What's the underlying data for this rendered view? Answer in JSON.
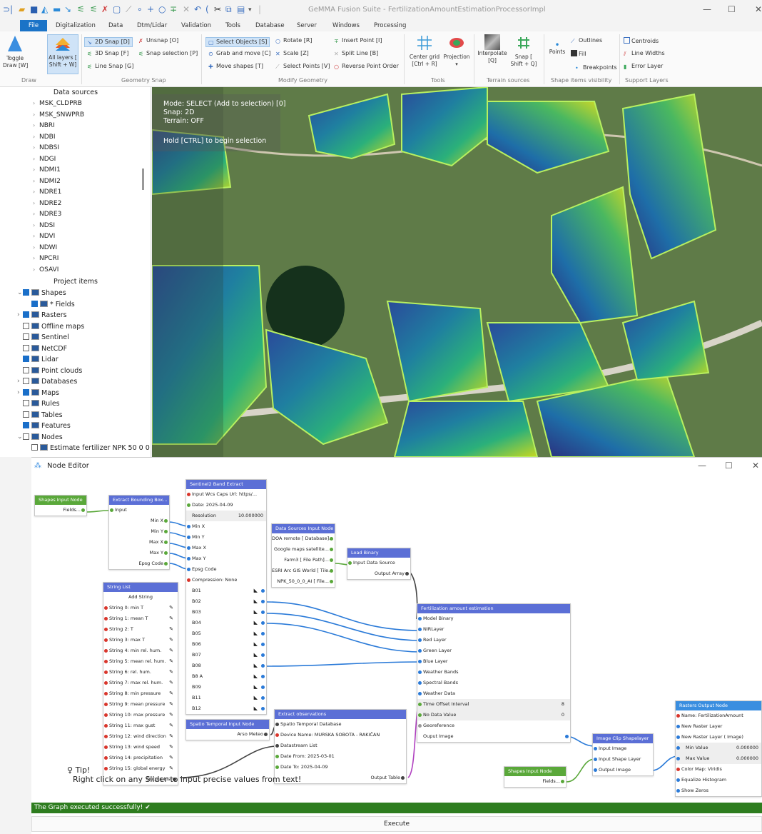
{
  "app": {
    "title": "GeMMA Fusion Suite - FertilizationAmountEstimationProcessorImpl"
  },
  "menu": [
    "File",
    "Digitalization",
    "Data",
    "Dtm/Lidar",
    "Validation",
    "Tools",
    "Database",
    "Server",
    "Windows",
    "Processing"
  ],
  "ribbon": {
    "toggle_draw": "Toggle\nDraw [W]",
    "all_layers": "All layers [\nShift + W]",
    "snap2d": "2D Snap [D]",
    "snap3d": "3D Snap [F]",
    "line_snap": "Line Snap [G]",
    "unsnap": "Unsnap [O]",
    "snap_selection": "Snap selection [P]",
    "select_objects": "Select Objects [S]",
    "grab_move": "Grab and move [C]",
    "move_shapes": "Move shapes [T]",
    "rotate": "Rotate [R]",
    "scale": "Scale [Z]",
    "select_points": "Select Points [V]",
    "insert_point": "Insert Point [I]",
    "split_line": "Split Line [B]",
    "reverse_point_order": "Reverse Point Order",
    "center_grid": "Center grid\n[Ctrl + R]",
    "projection": "Projection",
    "interpolate": "Interpolate\n[Q]",
    "snap_shift_q": "Snap [\nShift + Q]",
    "points": "Points",
    "outlines": "Outlines",
    "fill": "Fill",
    "breakpoints": "Breakpoints",
    "centroids": "Centroids",
    "line_widths": "Line Widths",
    "error_layer": "Error Layer",
    "groups": [
      "Draw",
      "Geometry Snap",
      "Modify Geometry",
      "Tools",
      "Terrain sources",
      "Shape items visibility",
      "Support Layers"
    ]
  },
  "data_sources": {
    "heading": "Data sources",
    "items": [
      "MSK_CLDPRB",
      "MSK_SNWPRB",
      "NBRI",
      "NDBI",
      "NDBSI",
      "NDGI",
      "NDMI1",
      "NDMI2",
      "NDRE1",
      "NDRE2",
      "NDRE3",
      "NDSI",
      "NDVI",
      "NDWI",
      "NPCRI",
      "OSAVI"
    ]
  },
  "project_items": {
    "heading": "Project items",
    "items": [
      {
        "label": "Shapes",
        "checked": true
      },
      {
        "label": "* Fields",
        "checked": true
      },
      {
        "label": "Rasters",
        "checked": true
      },
      {
        "label": "Offline maps",
        "checked": false
      },
      {
        "label": "Sentinel",
        "checked": false
      },
      {
        "label": "NetCDF",
        "checked": false
      },
      {
        "label": "Lidar",
        "checked": true
      },
      {
        "label": "Point clouds",
        "checked": false
      },
      {
        "label": "Databases",
        "checked": false
      },
      {
        "label": "Maps",
        "checked": true
      },
      {
        "label": "Rules",
        "checked": false
      },
      {
        "label": "Tables",
        "checked": false
      },
      {
        "label": "Features",
        "checked": true
      },
      {
        "label": "Nodes",
        "checked": false
      },
      {
        "label": "Estimate fertilizer NPK 50 0 0",
        "checked": false
      }
    ]
  },
  "map_info": {
    "mode": "Mode: SELECT (Add to selection) [0]",
    "snap": "Snap: 2D",
    "terrain": "Terrain: OFF",
    "hint": "Hold [CTRL] to begin selection"
  },
  "node_editor": {
    "title": "Node Editor",
    "shapes_input": {
      "title": "Shapes Input Node",
      "fields": "Fields..."
    },
    "bbox": {
      "title": "Extract Bounding Box...",
      "input": "Input",
      "outputs": [
        "Min X",
        "Min Y",
        "Max X",
        "Max Y",
        "Epsg Code"
      ]
    },
    "sentinel": {
      "title": "Sentinel2 Band Extract",
      "wcs": "Input Wcs Caps Url: https/...",
      "date": "Date: 2025-04-09",
      "resolution_label": "Resolution",
      "resolution_value": "10.000000",
      "inputs": [
        "Min X",
        "Min Y",
        "Max X",
        "Max Y",
        "Epsg Code"
      ],
      "compression": "Compression: None",
      "bands": [
        "B01",
        "B02",
        "B03",
        "B04",
        "B05",
        "B06",
        "B07",
        "B08",
        "B8 A",
        "B09",
        "B11",
        "B12"
      ]
    },
    "datasources": {
      "title": "Data Sources Input Node",
      "items": [
        "DOA remote [ Database]...",
        "Google maps satellite...",
        "Farm3 [ File Path]...",
        "ESRI Arc GIS World [ Tile...",
        "NPK_50_0_0_AI [ File..."
      ]
    },
    "load_binary": {
      "title": "Load Binary",
      "input": "Input Data Source",
      "output": "Output Array"
    },
    "string_list": {
      "title": "String List",
      "add": "Add String",
      "strings": [
        "String 0: min T",
        "String 1: mean T",
        "String 2: T",
        "String 3: max T",
        "String 4: min rel. hum.",
        "String 5: mean rel. hum.",
        "String 6: rel. hum.",
        "String 7: max rel. hum.",
        "String 8: min pressure",
        "String 9: mean pressure",
        "String 10: max pressure",
        "String 11: max gust",
        "String 12: wind direction",
        "String 13: wind speed",
        "String 14: precipitation",
        "String 15: global energy"
      ],
      "output": "Output List"
    },
    "spatio": {
      "title": "Spatio Temporal Input Node",
      "output": "Arso Meteo"
    },
    "extract_obs": {
      "title": "Extract observations",
      "db": "Spatio Temporal Database",
      "device": "Device Name: MURSKA SOBOTA - RAKIČAN",
      "list": "Datastream List",
      "from": "Date From: 2025-03-01",
      "to": "Date To: 2025-04-09",
      "output": "Output Table"
    },
    "fert": {
      "title": "Fertilization amount estimation",
      "rows": [
        "Model Binary",
        "NIRLayer",
        "Red Layer",
        "Green Layer",
        "Blue Layer",
        "Weather Bands",
        "Spectral Bands",
        "Weather Data"
      ],
      "time_offset_label": "Time Offset Interval",
      "time_offset_value": "8",
      "no_data_label": "No Data Value",
      "no_data_value": "0",
      "georef": "Georeference",
      "output": "Ouput Image"
    },
    "clip": {
      "title": "Image Clip Shapelayer",
      "rows": [
        "Input Image",
        "Input Shape Layer",
        "Output Image"
      ]
    },
    "shapes_input2": {
      "title": "Shapes Input Node",
      "fields": "Fields..."
    },
    "rasters_out": {
      "title": "Rasters Output Node",
      "name": "Name: FertilizationAmount",
      "new_layer": "New Raster Layer",
      "new_layer_img": "New Raster Layer ( Image)",
      "min_label": "Min Value",
      "min_value": "0.000000",
      "max_label": "Max Value",
      "max_value": "0.000000",
      "colormap": "Color Map: Viridis",
      "equalize": "Equalize Histogram",
      "show_zeros": "Show Zeros"
    }
  },
  "tip": {
    "title": "Tip!",
    "text": "Right click on any Slider to input precise values from text!"
  },
  "status": "The Graph executed successfully! ✔",
  "execute": "Execute",
  "colors": {
    "accent": "#1a73c7",
    "node_header": "#5b6fd6",
    "status_green": "#2e7d1f"
  }
}
